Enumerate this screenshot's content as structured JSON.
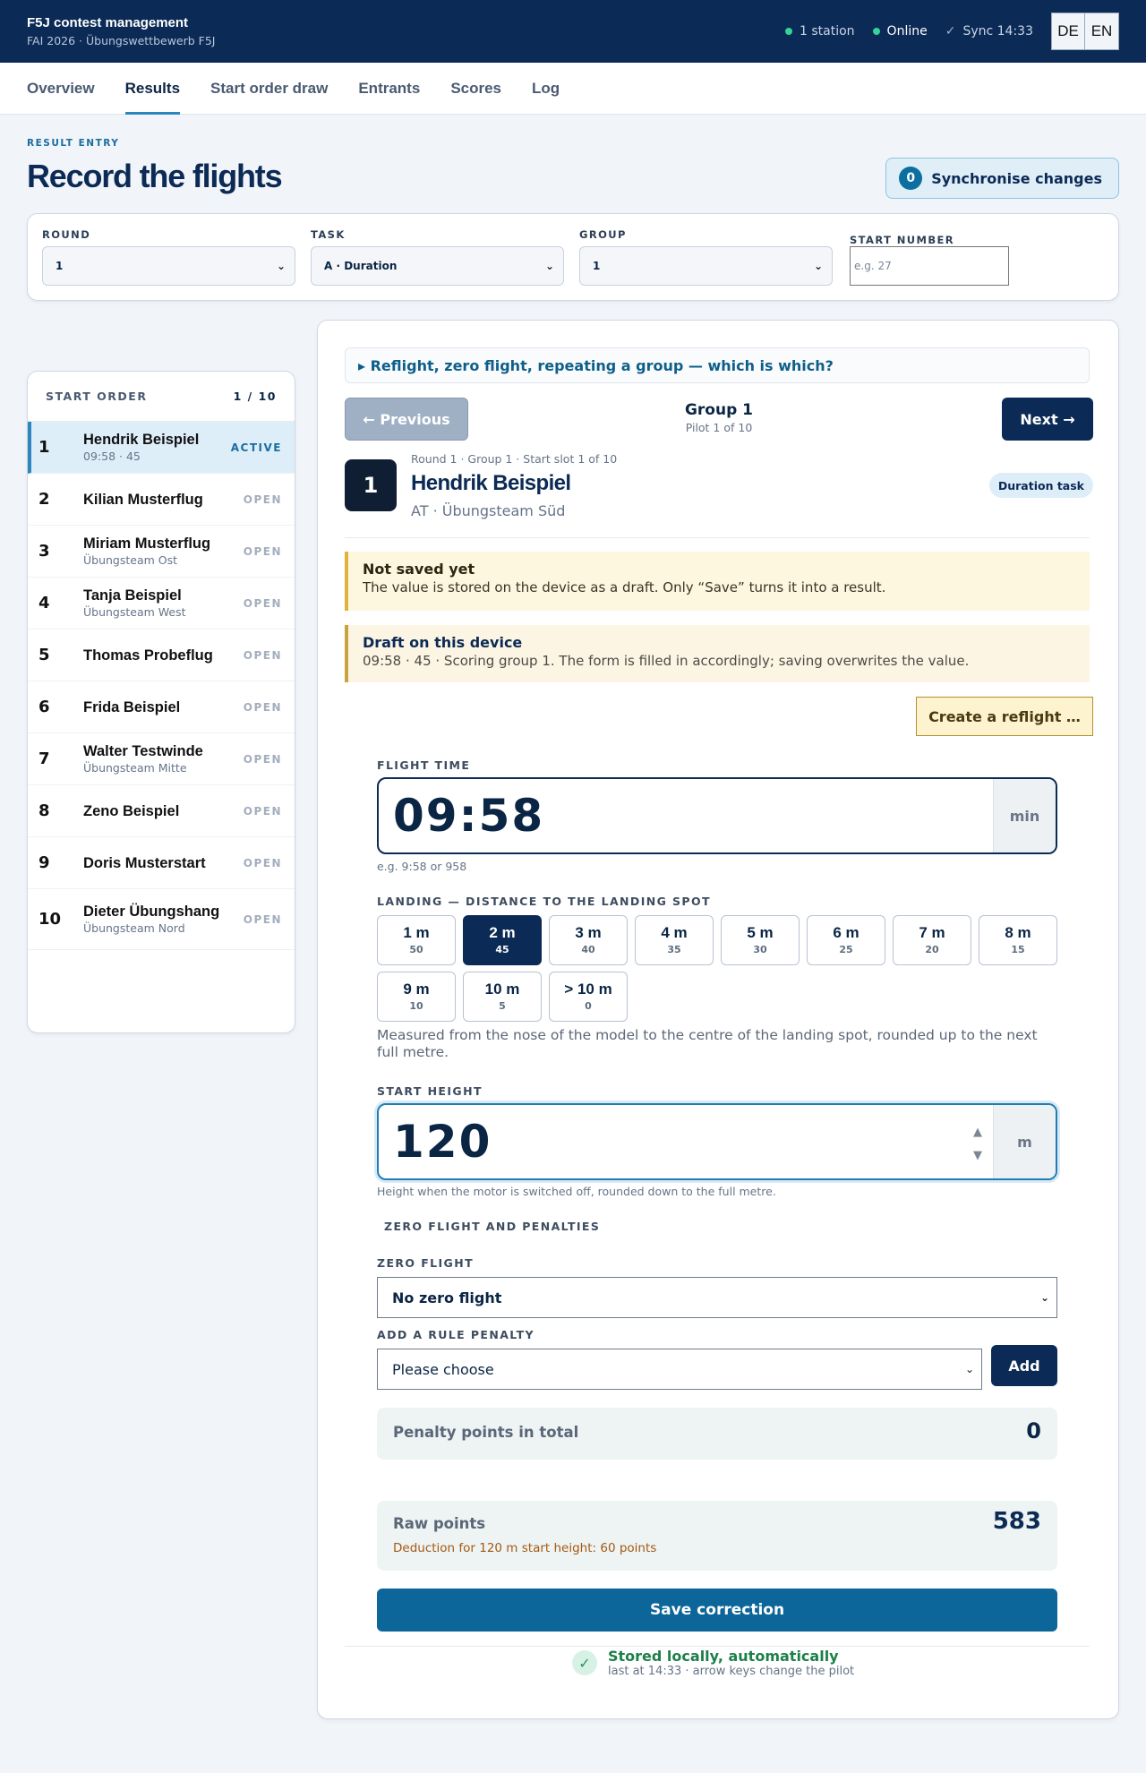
{
  "app": {
    "title": "F5J contest management",
    "subtitle": "FAI 2026 · Übungswettbewerb F5J"
  },
  "status": {
    "stations": "1 station",
    "online": "Online",
    "sync": "Sync 14:33"
  },
  "lang": {
    "de": "DE",
    "en": "EN"
  },
  "tabs": [
    {
      "label": "Overview"
    },
    {
      "label": "Results"
    },
    {
      "label": "Start order draw"
    },
    {
      "label": "Entrants"
    },
    {
      "label": "Scores"
    },
    {
      "label": "Log"
    }
  ],
  "header": {
    "eyebrow": "RESULT ENTRY",
    "title": "Record the flights",
    "sync_count": "0",
    "sync_label": "Synchronise changes"
  },
  "filters": {
    "round_label": "ROUND",
    "round_value": "1",
    "task_label": "TASK",
    "task_value": "A · Duration",
    "group_label": "GROUP",
    "group_value": "1",
    "start_number_label": "START NUMBER",
    "start_number_placeholder": "e.g. 27"
  },
  "start_order": {
    "title": "START ORDER",
    "count": "1 / 10",
    "pilots": [
      {
        "num": "1",
        "name": "Hendrik Beispiel",
        "sub": "09:58 · 45",
        "status": "ACTIVE"
      },
      {
        "num": "2",
        "name": "Kilian Musterflug",
        "sub": "",
        "status": "OPEN"
      },
      {
        "num": "3",
        "name": "Miriam Musterflug",
        "sub": "Übungsteam Ost",
        "status": "OPEN"
      },
      {
        "num": "4",
        "name": "Tanja Beispiel",
        "sub": "Übungsteam West",
        "status": "OPEN"
      },
      {
        "num": "5",
        "name": "Thomas Probeflug",
        "sub": "",
        "status": "OPEN"
      },
      {
        "num": "6",
        "name": "Frida Beispiel",
        "sub": "",
        "status": "OPEN"
      },
      {
        "num": "7",
        "name": "Walter Testwinde",
        "sub": "Übungsteam Mitte",
        "status": "OPEN"
      },
      {
        "num": "8",
        "name": "Zeno Beispiel",
        "sub": "",
        "status": "OPEN"
      },
      {
        "num": "9",
        "name": "Doris Musterstart",
        "sub": "",
        "status": "OPEN"
      },
      {
        "num": "10",
        "name": "Dieter Übungshang",
        "sub": "Übungsteam Nord",
        "status": "OPEN"
      }
    ]
  },
  "entry": {
    "details_summary": "▸ Reflight, zero flight, repeating a group — which is which?",
    "prev_label": "← Previous",
    "next_label": "Next →",
    "group_title": "Group 1",
    "group_sub": "Pilot 1 of 10",
    "pilot_number": "1",
    "pilot_meta": "Round 1 · Group 1 · Start slot 1 of 10",
    "pilot_name": "Hendrik Beispiel",
    "pilot_team": "AT · Übungsteam Süd",
    "task_badge": "Duration task",
    "notice1_title": "Not saved yet",
    "notice1_text": "The value is stored on the device as a draft. Only “Save” turns it into a result.",
    "notice2_title": "Draft on this device",
    "notice2_text": "09:58 · 45 · Scoring group 1. The form is filled in accordingly; saving overwrites the value.",
    "reflight_label": "Create a reflight …",
    "flight_time_label": "FLIGHT TIME",
    "flight_time_value": "09:58",
    "flight_time_unit": "min",
    "flight_time_hint": "e.g. 9:58 or 958",
    "landing_label": "LANDING — DISTANCE TO THE LANDING SPOT",
    "landing_options": [
      {
        "dist": "1 m",
        "pts": "50"
      },
      {
        "dist": "2 m",
        "pts": "45"
      },
      {
        "dist": "3 m",
        "pts": "40"
      },
      {
        "dist": "4 m",
        "pts": "35"
      },
      {
        "dist": "5 m",
        "pts": "30"
      },
      {
        "dist": "6 m",
        "pts": "25"
      },
      {
        "dist": "7 m",
        "pts": "20"
      },
      {
        "dist": "8 m",
        "pts": "15"
      },
      {
        "dist": "9 m",
        "pts": "10"
      },
      {
        "dist": "10 m",
        "pts": "5"
      },
      {
        "dist": "> 10 m",
        "pts": "0"
      }
    ],
    "landing_selected": "2 m",
    "landing_help": "Measured from the nose of the model to the centre of the landing spot, rounded up to the next full metre.",
    "start_height_label": "START HEIGHT",
    "start_height_value": "120",
    "start_height_unit": "m",
    "start_height_hint": "Height when the motor is switched off, rounded down to the full metre.",
    "zero_section_label": "ZERO FLIGHT AND PENALTIES",
    "zero_flight_label": "ZERO FLIGHT",
    "zero_flight_value": "No zero flight",
    "rule_penalty_label": "ADD A RULE PENALTY",
    "rule_penalty_value": "Please choose",
    "add_label": "Add",
    "penalty_total_label": "Penalty points in total",
    "penalty_total_value": "0",
    "raw_points_label": "Raw points",
    "raw_points_value": "583",
    "raw_points_note": "Deduction for 120 m start height: 60 points",
    "save_label": "Save correction",
    "stored_title": "Stored locally, automatically",
    "stored_sub": "last at 14:33 · arrow keys change the pilot"
  }
}
